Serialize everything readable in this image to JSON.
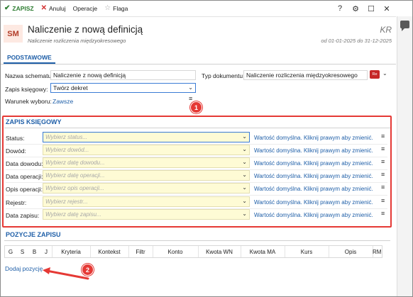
{
  "toolbar": {
    "save": "ZAPISZ",
    "cancel": "Anuluj",
    "operations": "Operacje",
    "flag": "Flaga",
    "help": "?"
  },
  "header": {
    "badge": "SM",
    "title": "Naliczenie z nową definicją",
    "subtitle": "Naliczenie rozliczenia międzyokresowego",
    "code": "KR",
    "period": "od 01-01-2025 do 31-12-2025"
  },
  "tabs": [
    {
      "label": "PODSTAWOWE"
    }
  ],
  "basic": {
    "scheme_name_label": "Nazwa schematu:",
    "scheme_name_value": "Naliczenie z nową definicją",
    "doc_type_label": "Typ dokumentu:",
    "doc_type_value": "Naliczenie rozliczenia międzyokresowego",
    "doc_type_badge": "Re",
    "booking_label": "Zapis księgowy:",
    "booking_value": "Twórz dekret",
    "condition_label": "Warunek wyboru:",
    "condition_value": "Zawsze"
  },
  "zapis": {
    "title": "ZAPIS KSIĘGOWY",
    "default_text": "Wartość domyślna. Kliknij prawym aby zmienić.",
    "rows": [
      {
        "label": "Status:",
        "placeholder": "Wybierz status..."
      },
      {
        "label": "Dowód:",
        "placeholder": "Wybierz dowód..."
      },
      {
        "label": "Data dowodu:",
        "placeholder": "Wybierz datę dowodu..."
      },
      {
        "label": "Data operacji:",
        "placeholder": "Wybierz datę operacji..."
      },
      {
        "label": "Opis operacji:",
        "placeholder": "Wybierz opis operacji..."
      },
      {
        "label": "Rejestr:",
        "placeholder": "Wybierz rejestr..."
      },
      {
        "label": "Data zapisu:",
        "placeholder": "Wybierz datę zapisu..."
      }
    ]
  },
  "positions": {
    "title": "POZYCJE ZAPISU",
    "columns": [
      "G",
      "S",
      "B",
      "J",
      "Kryteria",
      "Kontekst",
      "Filtr",
      "Konto",
      "Kwota WN",
      "Kwota MA",
      "Kurs",
      "Opis",
      "RM"
    ],
    "add_label": "Dodaj pozycję"
  },
  "annotations": [
    "1",
    "2"
  ],
  "colors": {
    "accent": "#1f5fa8",
    "annotation": "#e53935",
    "field_bg": "#fefbd5",
    "badge_bg": "#fde9e2"
  }
}
